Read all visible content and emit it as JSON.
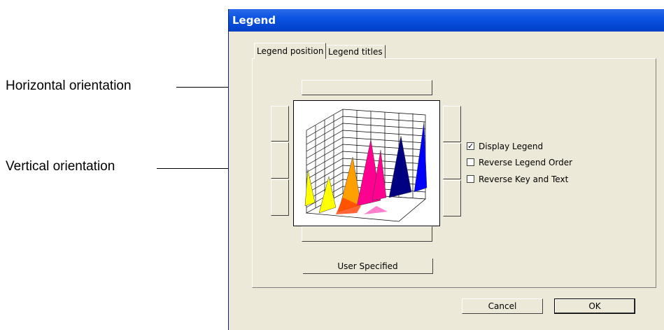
{
  "callouts": {
    "horizontal": "Horizontal orientation",
    "vertical": "Vertical orientation"
  },
  "dialog": {
    "title": "Legend",
    "tabs": [
      {
        "label": "Legend position",
        "active": true
      },
      {
        "label": "Legend titles",
        "active": false
      }
    ],
    "user_specified": "User Specified",
    "options": [
      {
        "label": "Display Legend",
        "checked": true
      },
      {
        "label": "Reverse Legend Order",
        "checked": false
      },
      {
        "label": "Reverse Key and Text",
        "checked": false
      }
    ],
    "buttons": {
      "cancel": "Cancel",
      "ok": "OK"
    }
  },
  "preview_colors": [
    "#ffff00",
    "#ffa000",
    "#ff4000",
    "#ff0090",
    "#000080",
    "#0000ff"
  ]
}
